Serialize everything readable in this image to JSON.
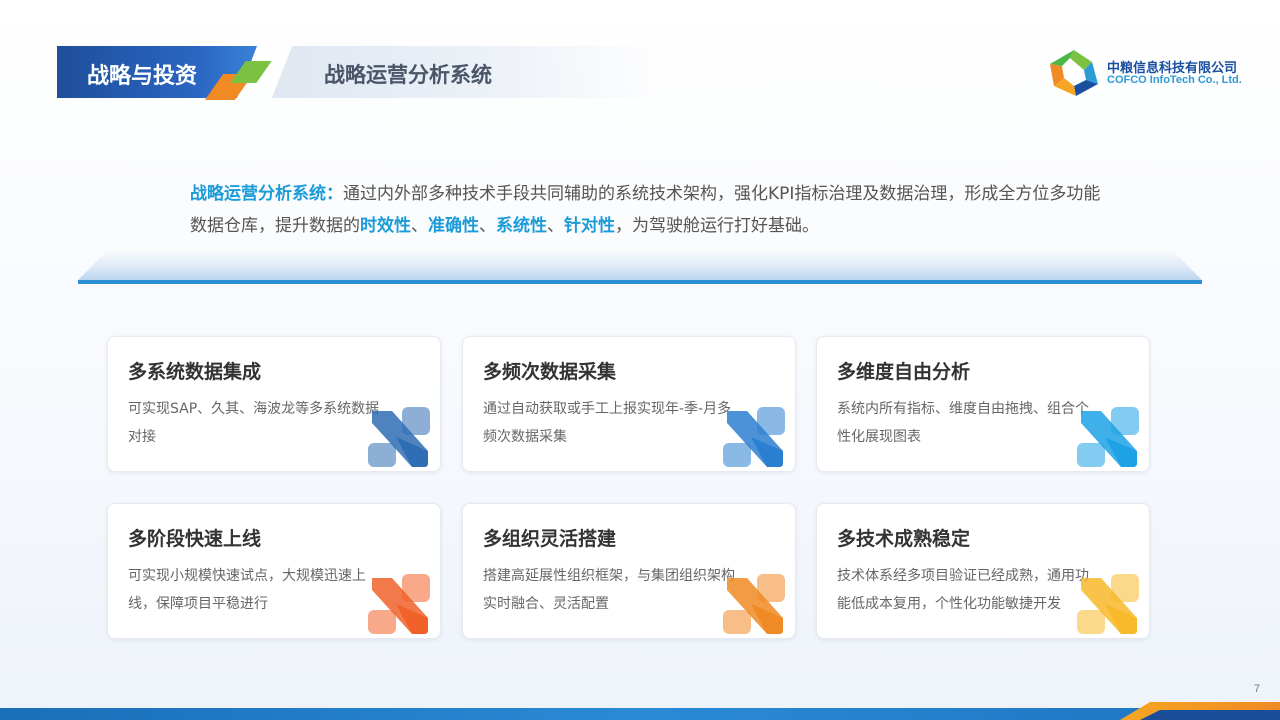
{
  "header": {
    "tag": "战略与投资",
    "subtitle": "战略运营分析系统"
  },
  "logo": {
    "name_cn": "中粮信息科技有限公司",
    "name_en": "COFCO InfoTech Co., Ltd."
  },
  "intro": {
    "lead": "战略运营分析系统：",
    "text1": "通过内外部多种技术手段共同辅助的系统技术架构，强化KPI指标治理及数据治理，形成全方位多功能数据仓库，提升数据的",
    "k1": "时效性",
    "sep1": "、",
    "k2": "准确性",
    "sep2": "、",
    "k3": "系统性",
    "sep3": "、",
    "k4": "针对性",
    "text2": "，为驾驶舱运行打好基础。"
  },
  "cards": [
    {
      "title": "多系统数据集成",
      "desc": "可实现SAP、久其、海波龙等多系统数据对接",
      "color": "#2f6db5"
    },
    {
      "title": "多频次数据采集",
      "desc": "通过自动获取或手工上报实现年-季-月多频次数据采集",
      "color": "#2b7fd0"
    },
    {
      "title": "多维度自由分析",
      "desc": "系统内所有指标、维度自由拖拽、组合个性化展现图表",
      "color": "#1ea2e6"
    },
    {
      "title": "多阶段快速上线",
      "desc": "可实现小规模快速试点，大规模迅速上线，保障项目平稳进行",
      "color": "#f0622a"
    },
    {
      "title": "多组织灵活搭建",
      "desc": "搭建高延展性组织框架，与集团组织架构实时融合、灵活配置",
      "color": "#f08a24"
    },
    {
      "title": "多技术成熟稳定",
      "desc": "技术体系经多项目验证已经成熟，通用功能低成本复用，个性化功能敏捷开发",
      "color": "#f8b92a"
    }
  ],
  "page_number": "7"
}
